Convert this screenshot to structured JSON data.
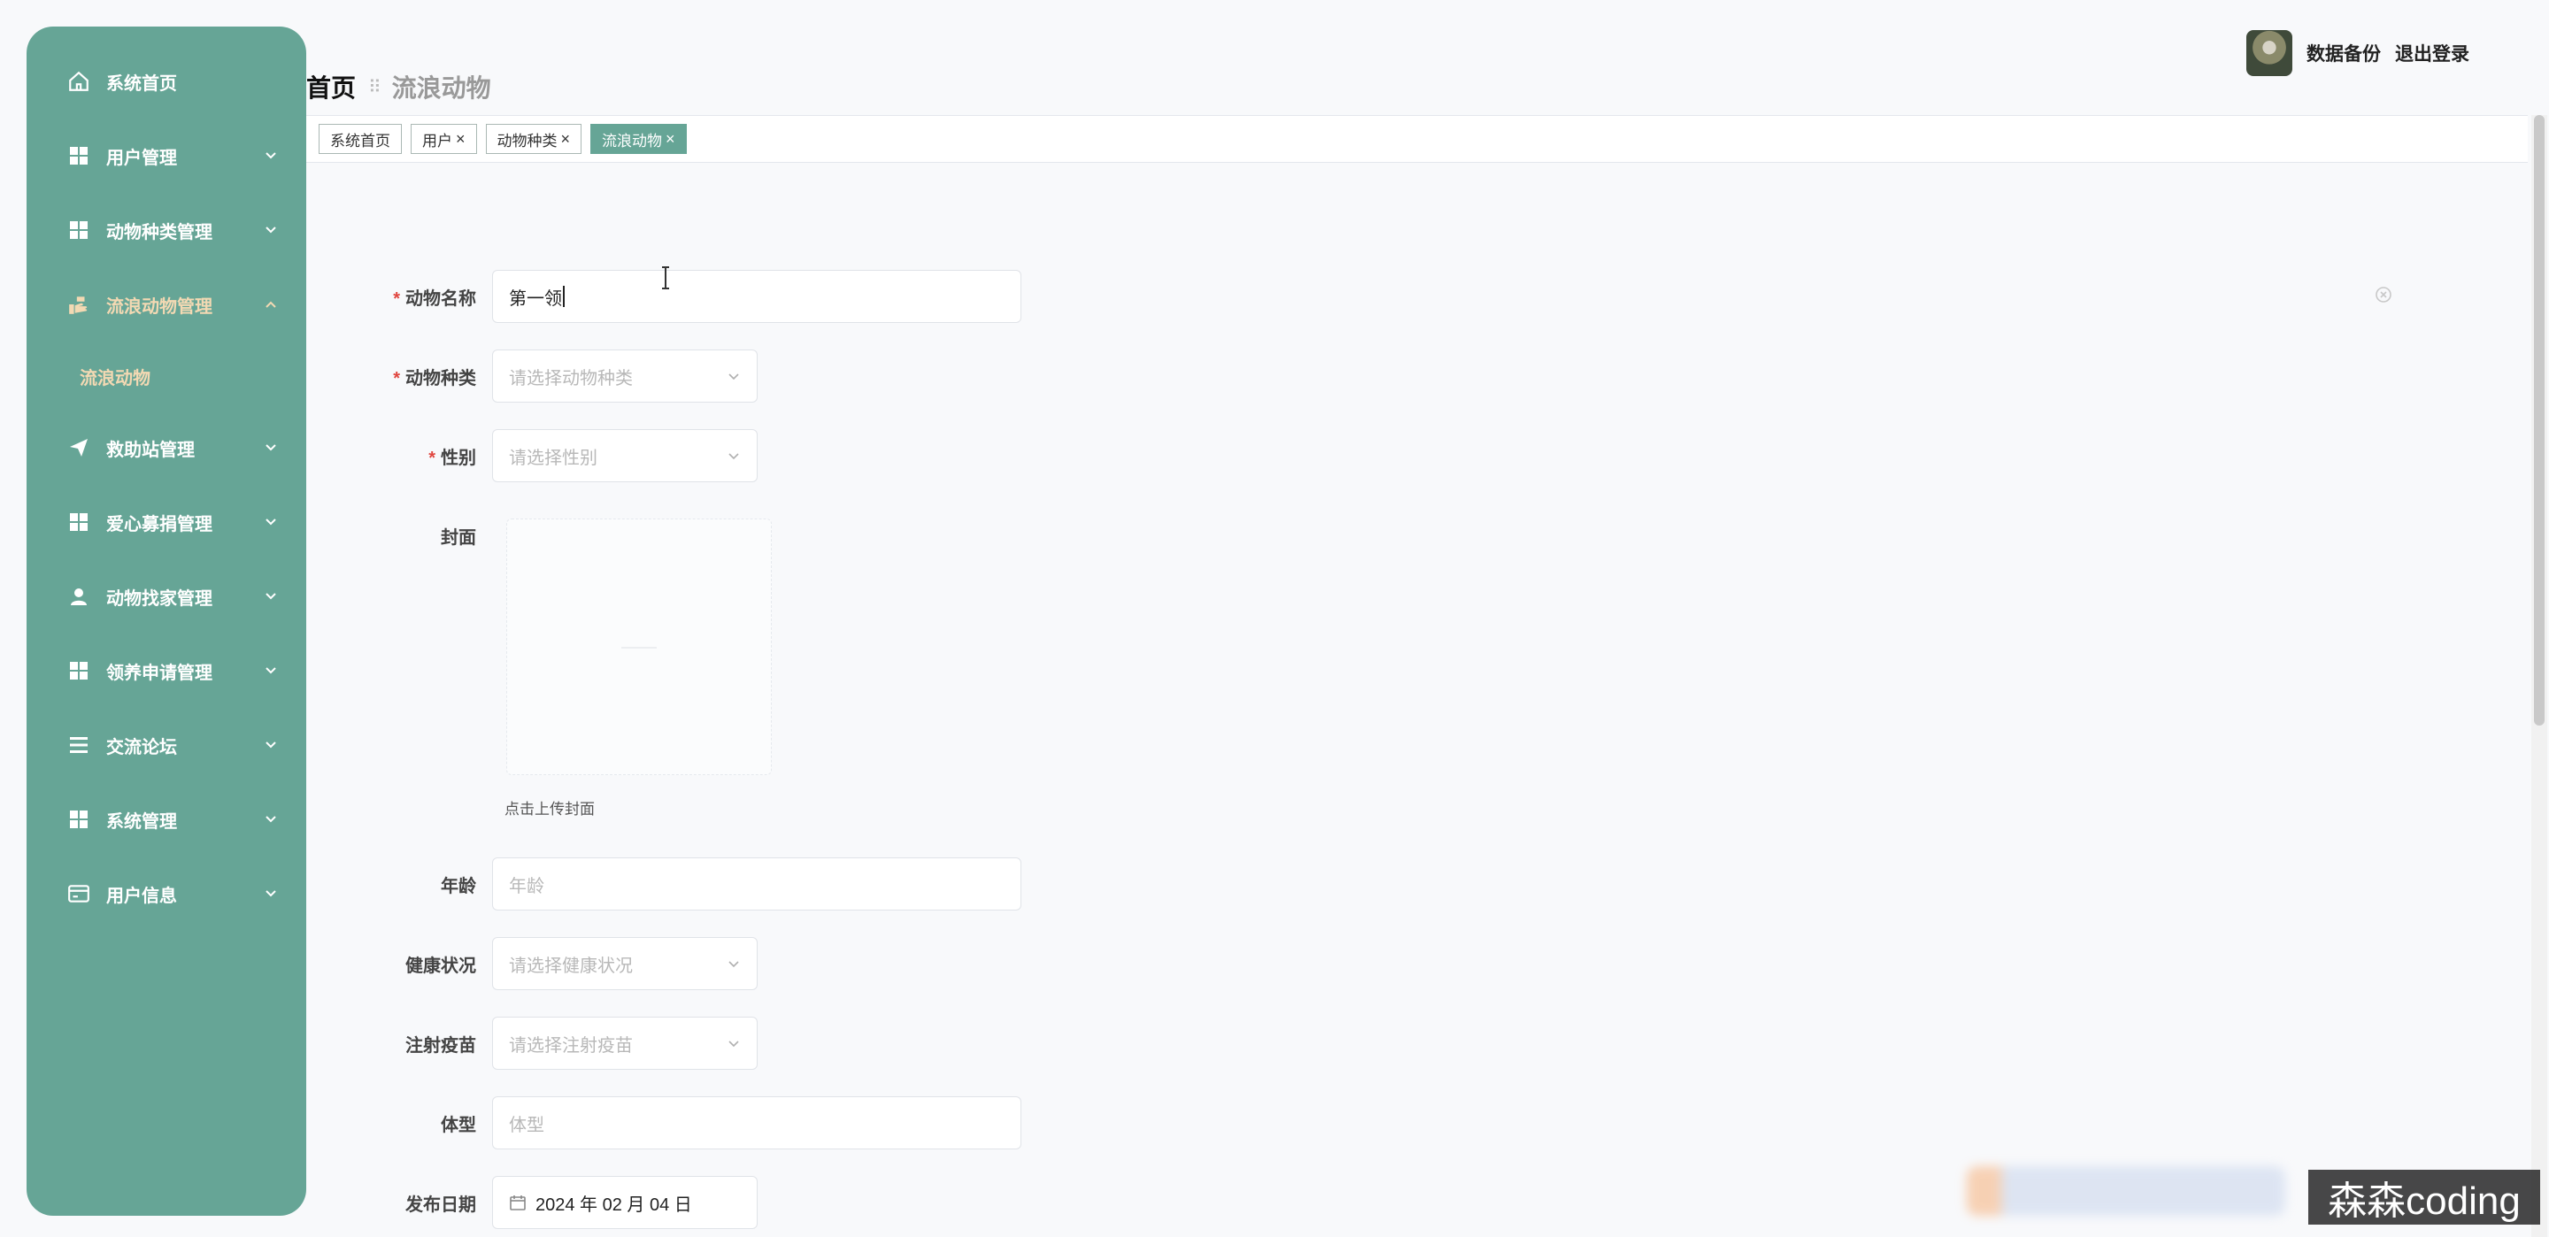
{
  "sidebar": {
    "items": [
      {
        "label": "系统首页",
        "icon": "home-icon"
      },
      {
        "label": "用户管理",
        "icon": "grid-icon"
      },
      {
        "label": "动物种类管理",
        "icon": "grid-icon"
      },
      {
        "label": "流浪动物管理",
        "icon": "hand-icon",
        "expanded": true
      },
      {
        "label": "救助站管理",
        "icon": "send-icon"
      },
      {
        "label": "爱心募捐管理",
        "icon": "grid-icon"
      },
      {
        "label": "动物找家管理",
        "icon": "user-icon"
      },
      {
        "label": "领养申请管理",
        "icon": "grid-icon"
      },
      {
        "label": "交流论坛",
        "icon": "list-icon"
      },
      {
        "label": "系统管理",
        "icon": "grid-icon"
      },
      {
        "label": "用户信息",
        "icon": "card-icon"
      }
    ],
    "submenu": {
      "label": "流浪动物"
    },
    "colors": {
      "bg": "#66a596",
      "active": "#f3d9b3"
    }
  },
  "header": {
    "breadcrumb_home": "首页",
    "breadcrumb_sep": "⠿",
    "breadcrumb_current": "流浪动物",
    "backup": "数据备份",
    "logout": "退出登录"
  },
  "tags": [
    {
      "label": "系统首页",
      "closable": false,
      "active": false
    },
    {
      "label": "用户",
      "closable": true,
      "active": false
    },
    {
      "label": "动物种类",
      "closable": true,
      "active": false
    },
    {
      "label": "流浪动物",
      "closable": true,
      "active": true
    }
  ],
  "tag_close": "×",
  "form": {
    "name": {
      "label": "动物名称",
      "value": "第一领"
    },
    "species": {
      "label": "动物种类",
      "placeholder": "请选择动物种类"
    },
    "gender": {
      "label": "性别",
      "placeholder": "请选择性别"
    },
    "cover": {
      "label": "封面",
      "hint": "点击上传封面"
    },
    "age": {
      "label": "年龄",
      "placeholder": "年龄"
    },
    "health": {
      "label": "健康状况",
      "placeholder": "请选择健康状况"
    },
    "vaccine": {
      "label": "注射疫苗",
      "placeholder": "请选择注射疫苗"
    },
    "size": {
      "label": "体型",
      "placeholder": "体型"
    },
    "date": {
      "label": "发布日期",
      "value": "2024 年 02 月 04 日"
    }
  },
  "required_mark": "*",
  "watermark": "森森coding"
}
